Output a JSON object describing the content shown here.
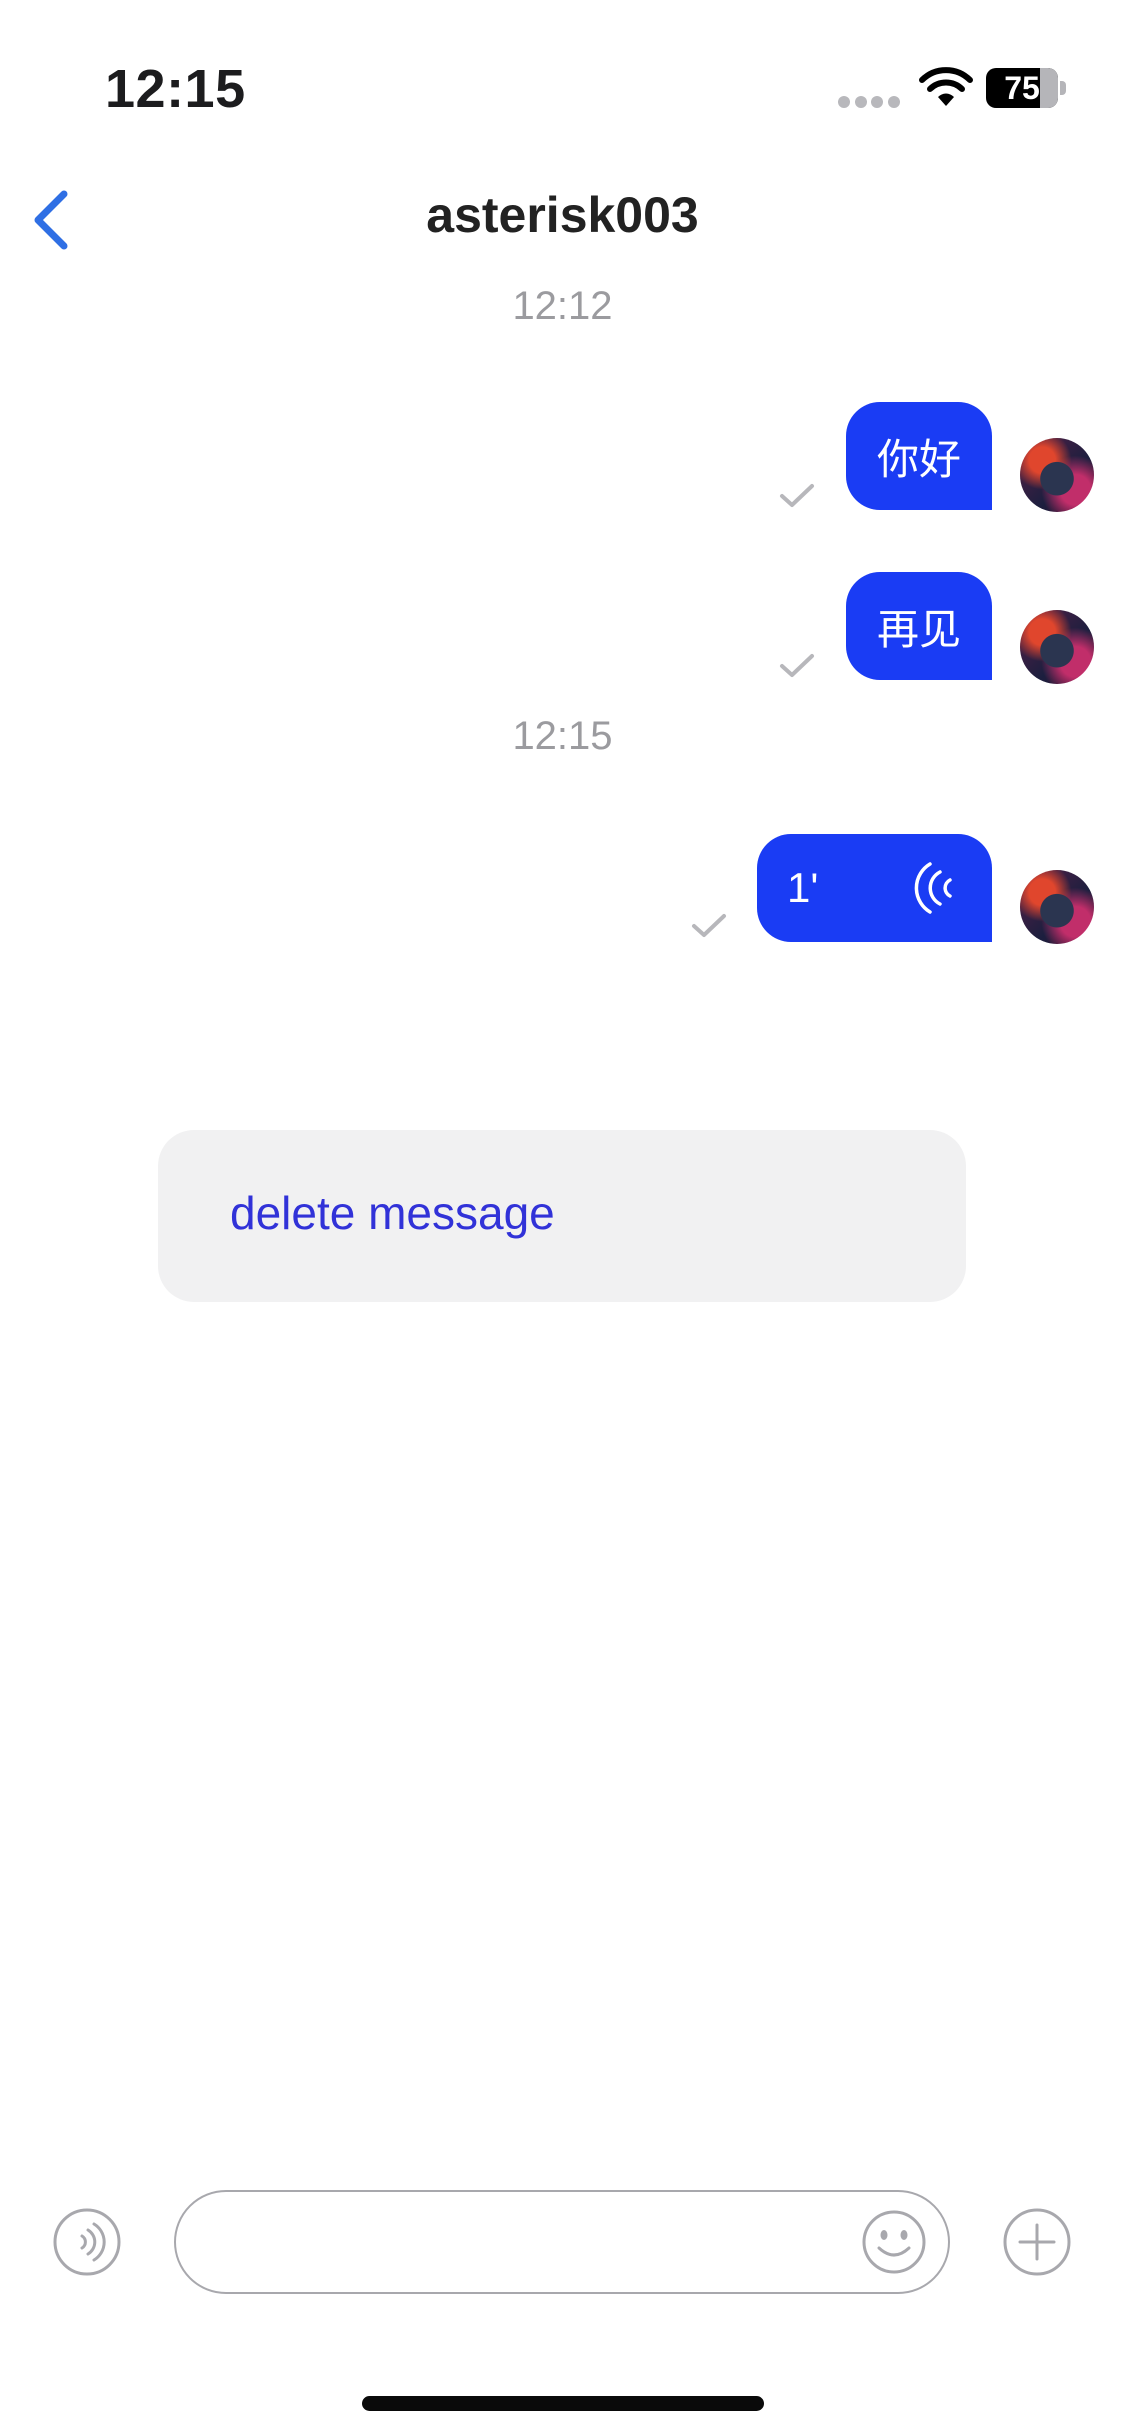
{
  "status_bar": {
    "time": "12:15",
    "battery_level": "75"
  },
  "header": {
    "title": "asterisk003",
    "back_icon": "chevron-left-icon"
  },
  "conversation": {
    "timestamps": [
      "12:12",
      "12:15"
    ],
    "messages": [
      {
        "text": "你好",
        "type": "text",
        "status": "sent"
      },
      {
        "text": "再见",
        "type": "text",
        "status": "sent"
      },
      {
        "text": "1'",
        "type": "voice",
        "status": "sent"
      }
    ]
  },
  "context_menu": {
    "delete_label": "delete message"
  },
  "input_bar": {
    "placeholder": "",
    "voice_icon": "voice-wave-icon",
    "emoji_icon": "smiley-icon",
    "plus_icon": "plus-circle-icon"
  },
  "colors": {
    "bubble": "#1a3cf4",
    "accent": "#2f6fe4",
    "menu_text": "#3132d8"
  }
}
